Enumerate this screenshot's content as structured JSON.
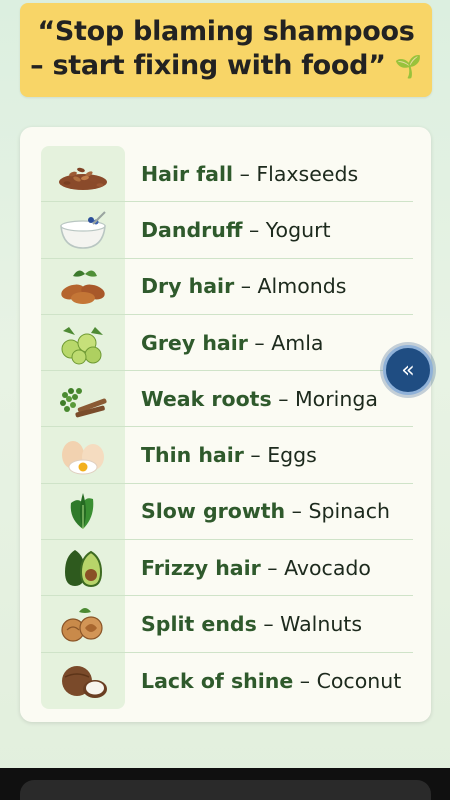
{
  "banner": {
    "line1": "“Stop blaming shampoos",
    "line2": "– start fixing with food”",
    "emoji": "🌱"
  },
  "rows": [
    {
      "problem": "Hair fall",
      "sep": " – ",
      "food": "Flaxseeds",
      "icon": "flaxseeds-icon"
    },
    {
      "problem": "Dandruff",
      "sep": " – ",
      "food": "Yogurt",
      "icon": "yogurt-icon"
    },
    {
      "problem": "Dry hair",
      "sep": " – ",
      "food": "Almonds",
      "icon": "almonds-icon"
    },
    {
      "problem": "Grey hair",
      "sep": " – ",
      "food": "Amla",
      "icon": "amla-icon"
    },
    {
      "problem": "Weak roots",
      "sep": " – ",
      "food": "Moringa",
      "icon": "moringa-icon"
    },
    {
      "problem": "Thin hair",
      "sep": " – ",
      "food": "Eggs",
      "icon": "eggs-icon"
    },
    {
      "problem": "Slow growth",
      "sep": " – ",
      "food": "Spinach",
      "icon": "spinach-icon"
    },
    {
      "problem": "Frizzy hair",
      "sep": " – ",
      "food": "Avocado",
      "icon": "avocado-icon"
    },
    {
      "problem": "Split ends",
      "sep": " – ",
      "food": "Walnuts",
      "icon": "walnuts-icon"
    },
    {
      "problem": "Lack of shine",
      "sep": " – ",
      "food": "Coconut",
      "icon": "coconut-icon"
    }
  ],
  "fab": {
    "glyph": "«"
  },
  "colors": {
    "banner": "#f8d567",
    "problem_text": "#2f5a2c",
    "fab": "#1f4d82"
  }
}
